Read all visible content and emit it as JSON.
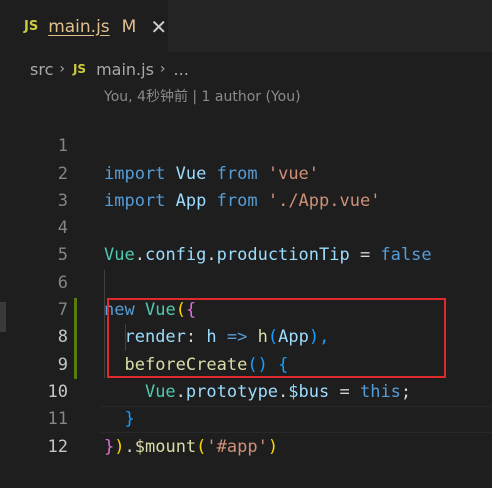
{
  "tab": {
    "icon": "JS",
    "filename": "main.js",
    "modified_marker": "M",
    "close_glyph": "✕"
  },
  "breadcrumb": {
    "folder": "src",
    "sep": "›",
    "icon": "JS",
    "file": "main.js",
    "more": "..."
  },
  "codelens": "You, 4秒钟前 | 1 author (You)",
  "lines": [
    {
      "num": "1"
    },
    {
      "num": "2"
    },
    {
      "num": "3"
    },
    {
      "num": "4"
    },
    {
      "num": "5"
    },
    {
      "num": "6"
    },
    {
      "num": "7"
    },
    {
      "num": "8"
    },
    {
      "num": "9"
    },
    {
      "num": "10"
    },
    {
      "num": "11"
    },
    {
      "num": "12"
    }
  ],
  "tokens": {
    "l1": [
      "import",
      " ",
      "Vue",
      " ",
      "from",
      " ",
      "'vue'"
    ],
    "l2": [
      "import",
      " ",
      "App",
      " ",
      "from",
      " ",
      "'./App.vue'"
    ],
    "l4": [
      "Vue",
      ".",
      "config",
      ".",
      "productionTip",
      " = ",
      "false"
    ],
    "l6": [
      "new",
      " ",
      "Vue",
      "(",
      "{"
    ],
    "l7": [
      "  ",
      "render",
      ": ",
      "h",
      " ",
      "=>",
      " ",
      "h",
      "(",
      "App",
      "),"
    ],
    "l8": [
      "  ",
      "beforeCreate",
      "(",
      ")",
      " ",
      "{"
    ],
    "l9": [
      "    ",
      "Vue",
      ".",
      "prototype",
      ".",
      "$bus",
      " = ",
      "this",
      ";"
    ],
    "l10": [
      "  ",
      "}"
    ],
    "l11": [
      "}",
      ")",
      ".",
      "$mount",
      "(",
      "'#app'",
      ")"
    ]
  },
  "colors": {
    "background": "#1e1e1e",
    "keyword": "#569cd6",
    "string": "#ce9178",
    "variable": "#9cdcfe",
    "function": "#dcdcaa",
    "class": "#4ec9b0",
    "highlight_border": "#e0292b",
    "git_modified": "#587c0c"
  }
}
